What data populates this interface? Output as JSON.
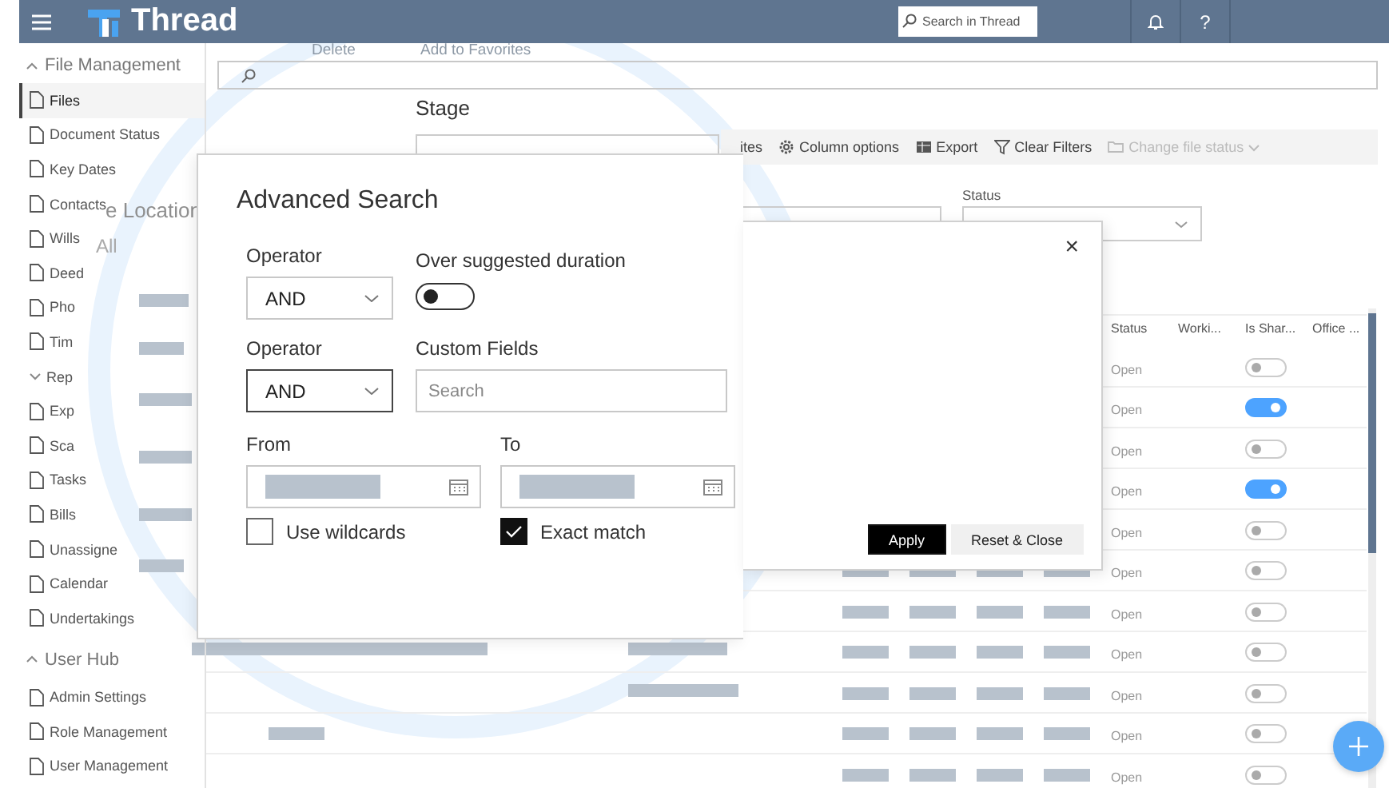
{
  "header": {
    "title": "Thread",
    "search": {
      "placeholder": "Search in Thread"
    },
    "help": "?"
  },
  "sidebar": {
    "sections": [
      {
        "label": "File Management",
        "expanded": true,
        "items": [
          {
            "label": "Files",
            "kind": "link",
            "selected": true
          },
          {
            "label": "Document Status",
            "kind": "link",
            "selected": false
          },
          {
            "label": "Key Dates",
            "kind": "link",
            "selected": false
          },
          {
            "label": "Contacts",
            "kind": "link",
            "selected": false
          },
          {
            "label": "Wills",
            "kind": "link",
            "selected": false
          },
          {
            "label": "Deed",
            "kind": "link",
            "selected": false
          },
          {
            "label": "Pho",
            "kind": "link",
            "selected": false
          },
          {
            "label": "Tim",
            "kind": "link",
            "selected": false
          },
          {
            "label": "Rep",
            "kind": "group",
            "selected": false,
            "expanded": false
          },
          {
            "label": "Exp",
            "kind": "link",
            "selected": false
          },
          {
            "label": "Sca",
            "kind": "link",
            "selected": false
          },
          {
            "label": "Tasks",
            "kind": "link",
            "selected": false
          },
          {
            "label": "Bills",
            "kind": "link",
            "selected": false
          },
          {
            "label": "Unassigne",
            "kind": "link",
            "selected": false
          },
          {
            "label": "Calendar",
            "kind": "link",
            "selected": false
          },
          {
            "label": "Undertakings",
            "kind": "link",
            "selected": false
          }
        ]
      },
      {
        "label": "User Hub",
        "expanded": true,
        "items": [
          {
            "label": "Admin Settings",
            "kind": "link",
            "selected": false
          },
          {
            "label": "Role Management",
            "kind": "link",
            "selected": false
          },
          {
            "label": "User Management",
            "kind": "link",
            "selected": false
          }
        ]
      }
    ]
  },
  "toolbar": {
    "items": [
      {
        "label": "ites",
        "kind": "text",
        "disabled": false
      },
      {
        "label": "Column options",
        "kind": "gear",
        "disabled": false
      },
      {
        "label": "Export",
        "kind": "sheet",
        "disabled": false
      },
      {
        "label": "Clear Filters",
        "kind": "filter",
        "disabled": false
      },
      {
        "label": "Change file status",
        "kind": "folder",
        "disabled": true
      }
    ]
  },
  "filters": {
    "status_label": "Status"
  },
  "table": {
    "columns": [
      "Status",
      "Worki...",
      "Is Shar...",
      "Office ..."
    ],
    "rows": [
      {
        "status": "Open",
        "shared": false
      },
      {
        "status": "Open",
        "shared": true
      },
      {
        "status": "Open",
        "shared": false
      },
      {
        "status": "Open",
        "shared": true
      },
      {
        "status": "Open",
        "shared": false
      },
      {
        "status": "Open",
        "shared": false
      },
      {
        "status": "Open",
        "shared": false
      },
      {
        "status": "Open",
        "shared": false
      },
      {
        "status": "Open",
        "shared": false
      },
      {
        "status": "Open",
        "shared": false
      },
      {
        "status": "Open",
        "shared": false
      }
    ]
  },
  "magnified": {
    "toolbar": [
      "Delete",
      "Add to Favorites"
    ],
    "stage_label": "Stage",
    "location_label": "e Location",
    "location_value": "All"
  },
  "dialog": {
    "title": "Advanced Search",
    "close": "×",
    "operator1": {
      "label": "Operator",
      "value": "AND",
      "focused": false
    },
    "duration": {
      "label": "Over suggested duration",
      "on": false
    },
    "operator2": {
      "label": "Operator",
      "value": "AND",
      "focused": true
    },
    "custom_fields": {
      "label": "Custom Fields",
      "placeholder": "Search"
    },
    "from": {
      "label": "From"
    },
    "to": {
      "label": "To"
    },
    "checks": [
      {
        "label": "Use wildcards",
        "checked": false
      },
      {
        "label": "Exact match",
        "checked": true
      }
    ],
    "buttons": [
      {
        "label": "Apply",
        "kind": "primary"
      },
      {
        "label": "Reset & Close",
        "kind": "secondary"
      }
    ]
  }
}
